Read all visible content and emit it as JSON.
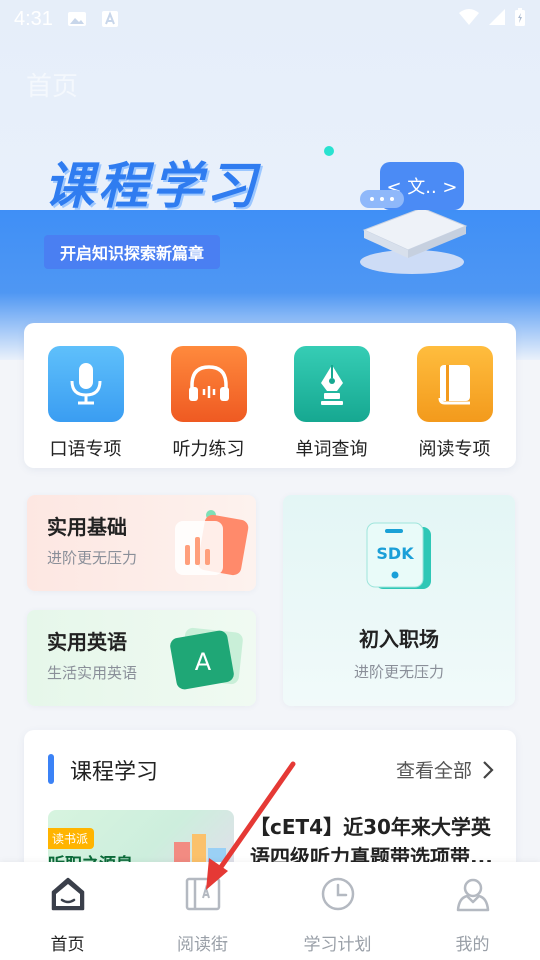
{
  "status_bar": {
    "time": "4:31"
  },
  "header": {
    "title": "首页"
  },
  "hero": {
    "title": "课程学习",
    "subtitle": "开启知识探索新篇章",
    "illus_text": "< 文.. >"
  },
  "quick_actions": [
    {
      "label": "口语专项",
      "icon": "microphone-icon",
      "color": "#3da7f5"
    },
    {
      "label": "听力练习",
      "icon": "headphones-icon",
      "color": "#f26a2e"
    },
    {
      "label": "单词查询",
      "icon": "pen-nib-icon",
      "color": "#1fb6a0"
    },
    {
      "label": "阅读专项",
      "icon": "book-icon",
      "color": "#f6a329"
    }
  ],
  "promos": {
    "basics": {
      "title": "实用基础",
      "subtitle": "进阶更无压力"
    },
    "english": {
      "title": "实用英语",
      "subtitle": "生活实用英语",
      "badge": "A"
    },
    "workplace": {
      "title": "初入职场",
      "subtitle": "进阶更无压力",
      "badge": "SDK"
    }
  },
  "courses": {
    "section_title": "课程学习",
    "see_all": "查看全部",
    "items": [
      {
        "title": "【cET4】近30年来大学英语四级听力真题带选项带...",
        "thumb_tag": "读书派",
        "thumb_text": "听职之源泉"
      }
    ]
  },
  "tabbar": [
    {
      "label": "首页",
      "icon": "home-icon",
      "active": true
    },
    {
      "label": "阅读街",
      "icon": "reading-icon",
      "active": false
    },
    {
      "label": "学习计划",
      "icon": "clock-icon",
      "active": false
    },
    {
      "label": "我的",
      "icon": "profile-icon",
      "active": false
    }
  ]
}
